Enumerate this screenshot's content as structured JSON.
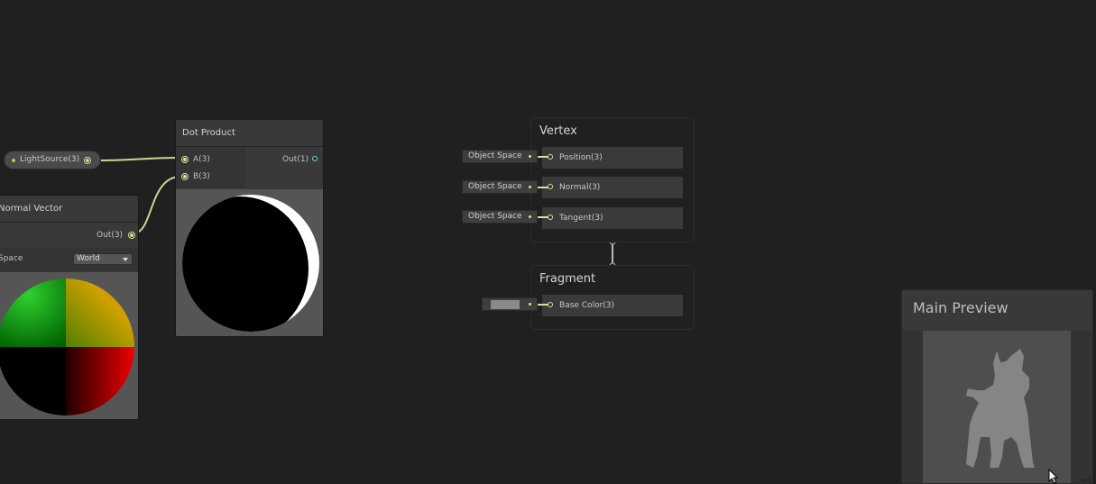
{
  "property": {
    "label": "LightSource(3)"
  },
  "dot_product": {
    "title": "Dot Product",
    "input_a": "A(3)",
    "input_b": "B(3)",
    "output": "Out(1)"
  },
  "normal_vector": {
    "title": "Normal Vector",
    "output": "Out(3)",
    "space_label": "Space",
    "space_value": "World"
  },
  "vertex": {
    "title": "Vertex",
    "slots": [
      {
        "field": "Object Space",
        "label": "Position(3)"
      },
      {
        "field": "Object Space",
        "label": "Normal(3)"
      },
      {
        "field": "Object Space",
        "label": "Tangent(3)"
      }
    ]
  },
  "fragment": {
    "title": "Fragment",
    "slots": [
      {
        "label": "Base Color(3)",
        "color": "#8a8a8a"
      }
    ]
  },
  "main_preview": {
    "title": "Main Preview"
  },
  "colors": {
    "background": "#202020",
    "port": "#d5e19c",
    "wire": "#cbd68f",
    "output_port_float": "#7fd3d6"
  },
  "icons": [
    "node-port-icon",
    "dropdown-arrow-icon",
    "mouse-cursor-icon",
    "resize-handle-icon"
  ]
}
